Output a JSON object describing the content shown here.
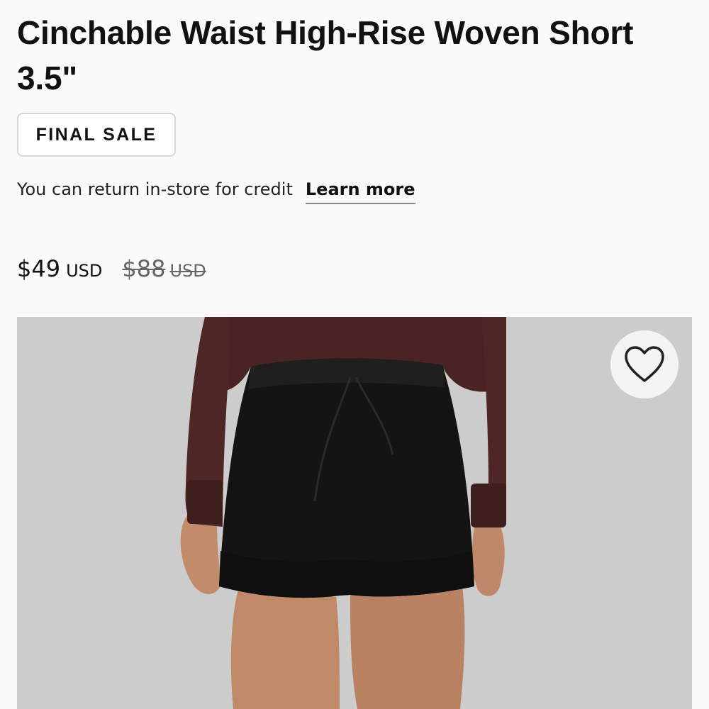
{
  "product": {
    "title": "Cinchable Waist High-Rise Woven Short 3.5\"",
    "badge": "FINAL SALE",
    "return_text": "You can return in-store for credit",
    "learn_more_label": "Learn more",
    "price": {
      "current_amount": "$49",
      "current_currency": "USD",
      "original_amount": "$88",
      "original_currency": "USD"
    }
  },
  "image": {
    "description_icon": "product-photo",
    "favorite_icon": "heart-outline-icon"
  },
  "colors": {
    "sweater": "#4a2424",
    "shorts": "#111111",
    "background": "#fafafa",
    "image_background": "#cdcdcd"
  }
}
